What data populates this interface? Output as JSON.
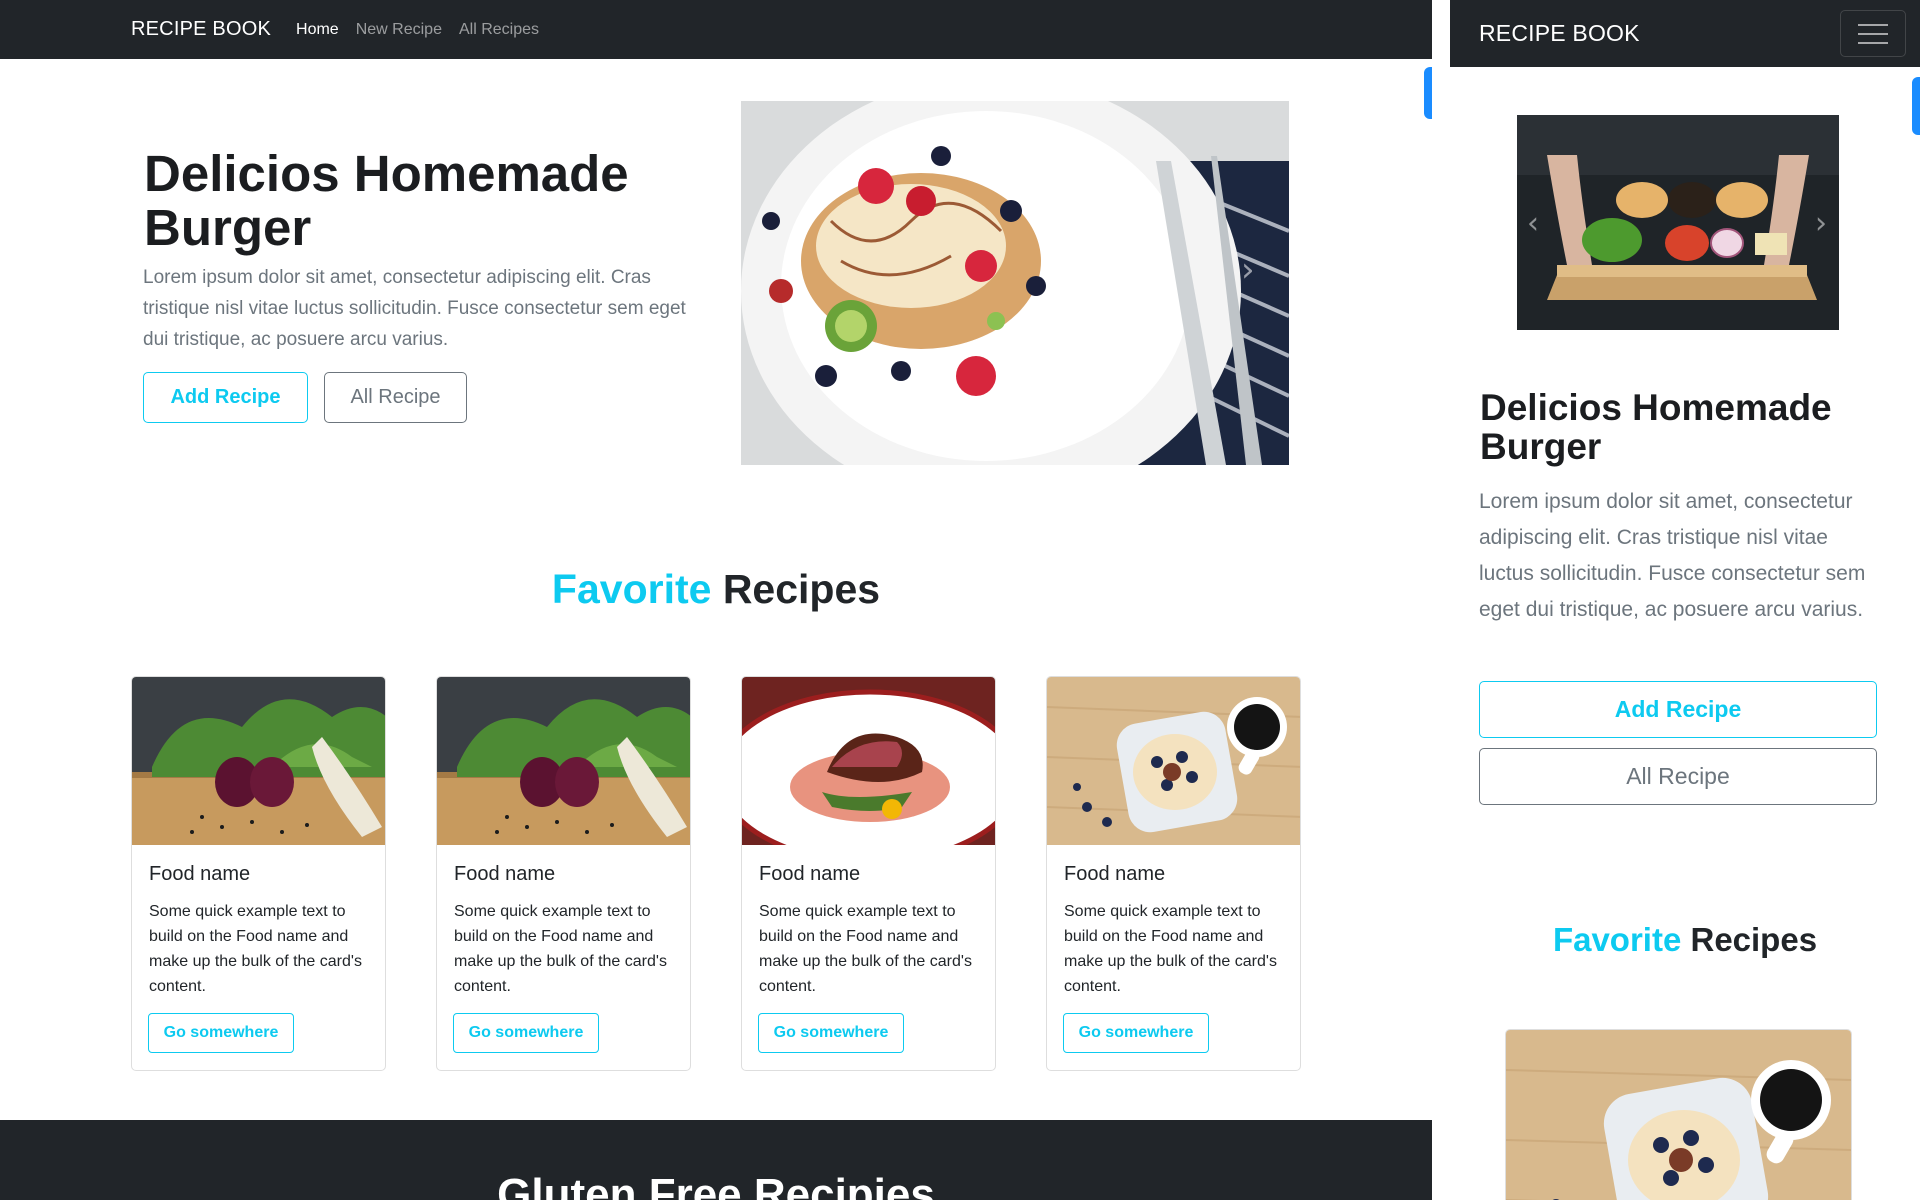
{
  "desktop": {
    "nav": {
      "brand": "RECIPE BOOK",
      "links": [
        "Home",
        "New Recipe",
        "All Recipes"
      ]
    },
    "hero": {
      "title": "Delicios Homemade Burger",
      "text": "Lorem ipsum dolor sit amet, consectetur adipiscing elit. Cras tristique nisl vitae luctus sollicitudin. Fusce consectetur sem eget dui tristique, ac posuere arcu varius.",
      "add_button": "Add Recipe",
      "all_button": "All Recipe"
    },
    "favorites": {
      "title_accent": "Favorite",
      "title_rest": " Recipes",
      "cards": [
        {
          "title": "Food name",
          "text": "Some quick example text to build on the Food name and make up the bulk of the card's content.",
          "button": "Go somewhere"
        },
        {
          "title": "Food name",
          "text": "Some quick example text to build on the Food name and make up the bulk of the card's content.",
          "button": "Go somewhere"
        },
        {
          "title": "Food name",
          "text": "Some quick example text to build on the Food name and make up the bulk of the card's content.",
          "button": "Go somewhere"
        },
        {
          "title": "Food name",
          "text": "Some quick example text to build on the Food name and make up the bulk of the card's content.",
          "button": "Go somewhere"
        }
      ]
    },
    "gluten": {
      "title": "Gluten Free Recipies"
    }
  },
  "mobile": {
    "nav": {
      "brand": "RECIPE BOOK"
    },
    "hero": {
      "title": "Delicios Homemade Burger",
      "text": "Lorem ipsum dolor sit amet, consectetur adipiscing elit. Cras tristique nisl vitae luctus sollicitudin. Fusce consectetur sem eget dui tristique, ac posuere arcu varius.",
      "add_button": "Add Recipe",
      "all_button": "All Recipe"
    },
    "favorites": {
      "title_accent": "Favorite",
      "title_rest": " Recipes"
    }
  },
  "colors": {
    "navbar": "#212529",
    "accent": "#0dcaf0",
    "secondary": "#6c757d",
    "scroll_tab": "#1a8cff"
  }
}
